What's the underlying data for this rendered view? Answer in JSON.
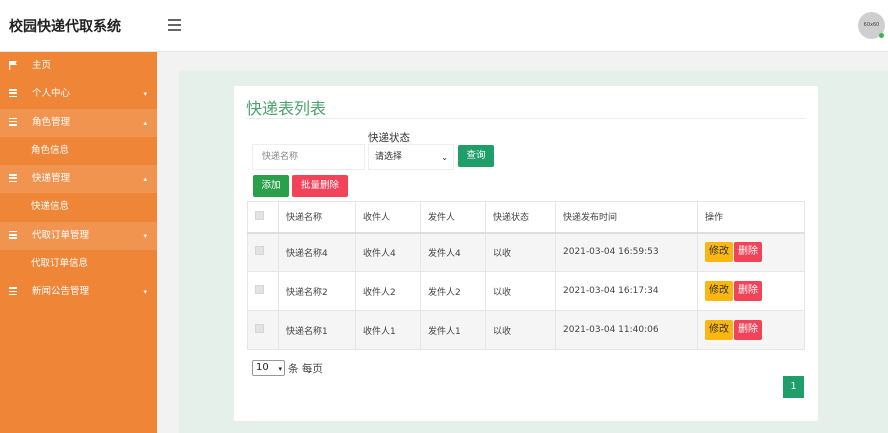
{
  "header": {
    "app_title": "校园快递代取系统",
    "avatar_text": "60x60"
  },
  "sidebar": {
    "items": [
      {
        "label": "主页",
        "icon": "flag-icon"
      },
      {
        "label": "个人中心",
        "icon": "list-icon",
        "caret": "▾"
      },
      {
        "label": "角色管理",
        "icon": "list-icon",
        "caret": "▴"
      },
      {
        "label": "角色信息"
      },
      {
        "label": "快递管理",
        "icon": "list-icon",
        "caret": "▴"
      },
      {
        "label": "快递信息"
      },
      {
        "label": "代取订单管理",
        "icon": "list-icon",
        "caret": "▾"
      },
      {
        "label": "代取订单信息"
      },
      {
        "label": "新闻公告管理",
        "icon": "list-icon",
        "caret": "▾"
      }
    ]
  },
  "main": {
    "card_title": "快递表列表",
    "status_label": "快递状态",
    "search_placeholder": "快递名称",
    "status_select_value": "请选择",
    "query_label": "查询",
    "add_label": "添加",
    "batch_delete_label": "批量删除",
    "table": {
      "headers": [
        "快递名称",
        "收件人",
        "发件人",
        "快递状态",
        "快递发布时间",
        "操作"
      ],
      "rows": [
        [
          "快递名称4",
          "收件人4",
          "发件人4",
          "以收",
          "2021-03-04 16:59:53"
        ],
        [
          "快递名称2",
          "收件人2",
          "发件人2",
          "以收",
          "2021-03-04 16:17:34"
        ],
        [
          "快递名称1",
          "收件人1",
          "发件人1",
          "以收",
          "2021-03-04 11:40:06"
        ]
      ],
      "edit_label": "修改",
      "delete_label": "删除"
    },
    "page_size": "10",
    "page_size_suffix": "条 每页",
    "current_page": "1"
  },
  "colors": {
    "sidebar": "#ee8537",
    "accent_green": "#1f9e6a",
    "danger": "#f24359",
    "warning": "#f9b711"
  }
}
